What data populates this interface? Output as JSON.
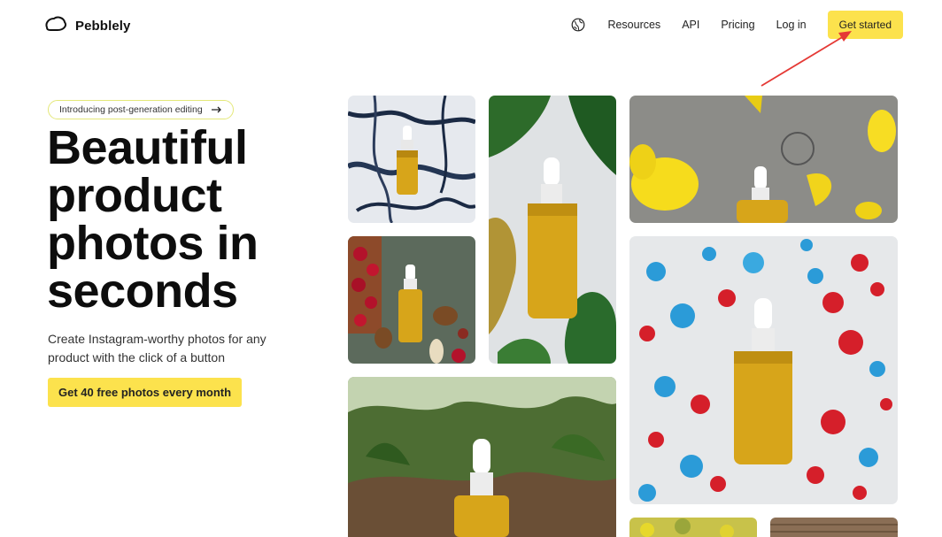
{
  "brand": {
    "name": "Pebblely"
  },
  "nav": {
    "links": [
      "Resources",
      "API",
      "Pricing",
      "Log in"
    ],
    "cta": "Get started"
  },
  "hero": {
    "pill": "Introducing post-generation editing",
    "headline": [
      "Beautiful",
      "product",
      "photos in",
      "seconds"
    ],
    "subtext": "Create Instagram-worthy photos for any product with the click of a button",
    "cta": "Get 40 free photos every month"
  },
  "colors": {
    "accent": "#fce24d",
    "annotation": "#e53935"
  },
  "gallery": [
    {
      "name": "marble-serum-photo"
    },
    {
      "name": "tropical-leaves-serum-photo"
    },
    {
      "name": "yellow-flowers-serum-photo"
    },
    {
      "name": "nuts-berries-serum-photo"
    },
    {
      "name": "paint-splatter-serum-photo"
    },
    {
      "name": "forest-floor-serum-photo"
    },
    {
      "name": "flowers-bottom-photo"
    },
    {
      "name": "wood-bottom-photo"
    }
  ]
}
